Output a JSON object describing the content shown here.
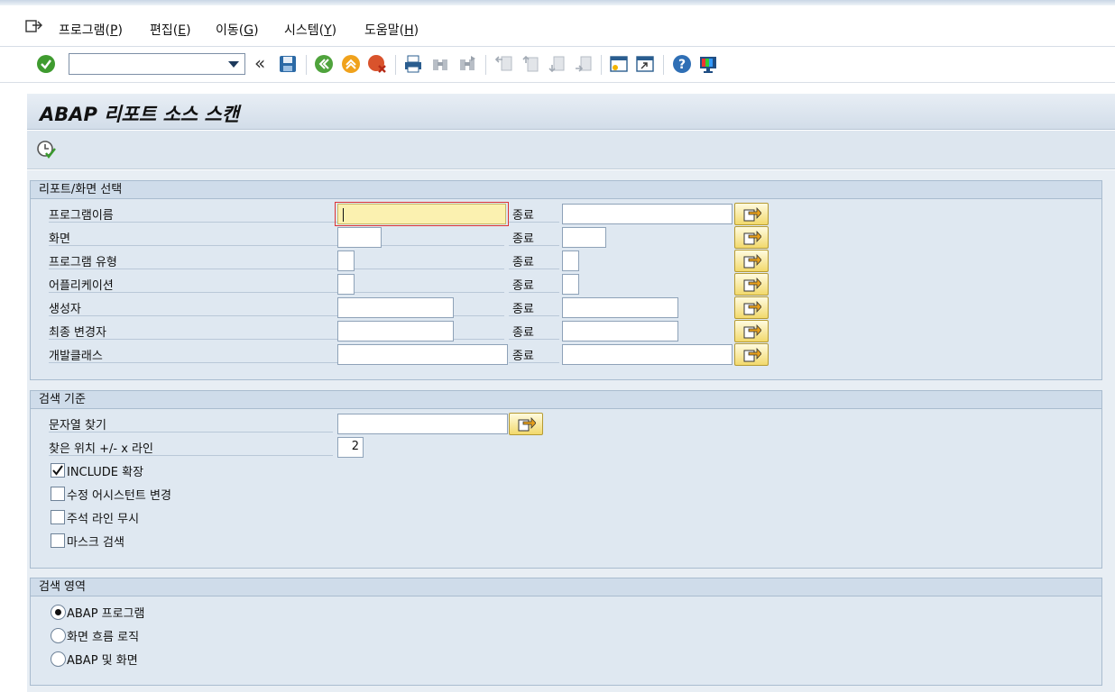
{
  "menu": {
    "items": [
      {
        "label": "프로그램(",
        "mnemonic": "P",
        "tail": ")"
      },
      {
        "label": "편집(",
        "mnemonic": "E",
        "tail": ")"
      },
      {
        "label": "이동(",
        "mnemonic": "G",
        "tail": ")"
      },
      {
        "label": "시스템(",
        "mnemonic": "Y",
        "tail": ")"
      },
      {
        "label": "도움말(",
        "mnemonic": "H",
        "tail": ")"
      }
    ]
  },
  "toolbar": {
    "command_field_value": "",
    "icons": [
      "enter-icon",
      "save-icon",
      "back-icon",
      "exit-icon",
      "cancel-icon",
      "print-icon",
      "find-icon",
      "find-next-icon",
      "first-page-icon",
      "previous-page-icon",
      "next-page-icon",
      "last-page-icon",
      "create-session-icon",
      "shortcut-icon",
      "help-icon",
      "customize-layout-icon"
    ]
  },
  "page": {
    "title": "ABAP 리포트 소스 스캔"
  },
  "report_selection": {
    "heading": "리포트/화면 선택",
    "to_label": "종료",
    "rows": [
      {
        "label": "프로그램이름",
        "from": "",
        "to": ""
      },
      {
        "label": "화면",
        "from": "",
        "to": ""
      },
      {
        "label": "프로그램 유형",
        "from": "",
        "to": ""
      },
      {
        "label": "어플리케이션",
        "from": "",
        "to": ""
      },
      {
        "label": "생성자",
        "from": "",
        "to": ""
      },
      {
        "label": "최종 변경자",
        "from": "",
        "to": ""
      },
      {
        "label": "개발클래스",
        "from": "",
        "to": ""
      }
    ]
  },
  "search_criteria": {
    "heading": "검색 기준",
    "find_string_label": "문자열 찾기",
    "find_string_value": "",
    "found_position_label": "찾은 위치 +/- x 라인",
    "found_position_value": "2",
    "checkboxes": [
      {
        "label": "INCLUDE 확장",
        "checked": true
      },
      {
        "label": "수정 어시스턴트 변경",
        "checked": false
      },
      {
        "label": "주석 라인 무시",
        "checked": false
      },
      {
        "label": "마스크 검색",
        "checked": false
      }
    ]
  },
  "search_area": {
    "heading": "검색 영역",
    "options": [
      {
        "label": "ABAP 프로그램",
        "selected": true
      },
      {
        "label": "화면 흐름 로직",
        "selected": false
      },
      {
        "label": "ABAP 및 화면",
        "selected": false
      }
    ]
  }
}
